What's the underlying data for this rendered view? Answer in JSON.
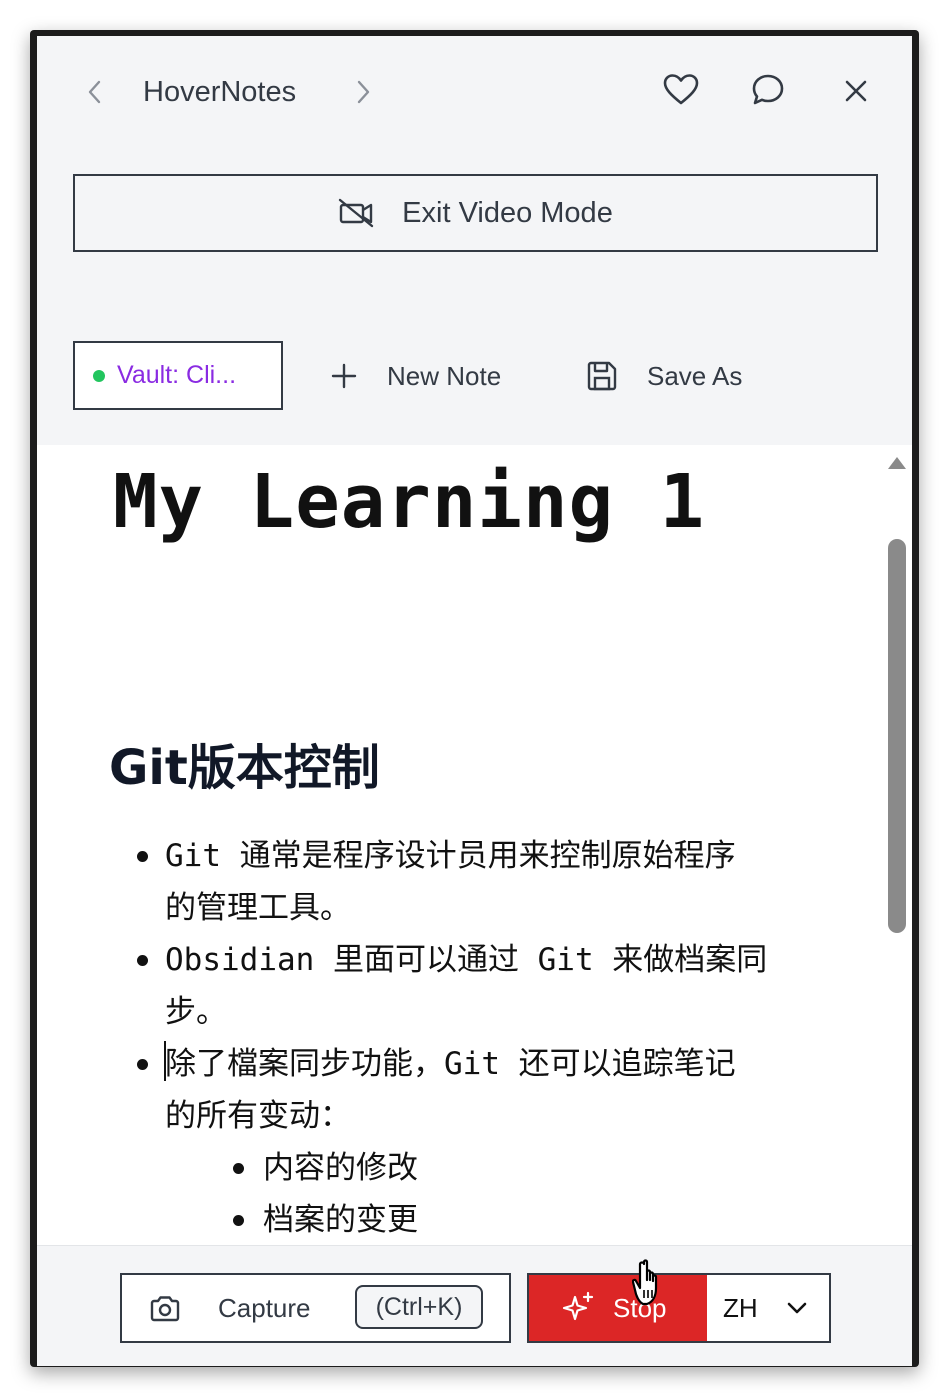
{
  "header": {
    "title": "HoverNotes"
  },
  "exit_video": {
    "label": "Exit Video Mode"
  },
  "toolbar": {
    "vault_label": "Vault: Cli...",
    "new_note_label": "New Note",
    "save_as_label": "Save As"
  },
  "document": {
    "title": "My Learning 1",
    "heading": "Git版本控制",
    "bullets": [
      {
        "line1": "Git 通常是程序设计员用来控制原始程序",
        "line2": "的管理工具。"
      },
      {
        "line1": "Obsidian 里面可以通过 Git 来做档案同",
        "line2": "步。"
      },
      {
        "line1": "除了檔案同步功能，Git 还可以追踪笔记",
        "line2": "的所有变动："
      }
    ],
    "sub_bullets": [
      "内容的修改",
      "档案的变更"
    ]
  },
  "footer": {
    "capture_label": "Capture",
    "capture_shortcut": "(Ctrl+K)",
    "stop_label": "Stop",
    "language": "ZH"
  },
  "colors": {
    "accent": "#dc2626",
    "vault_text": "#8a2be2",
    "status_dot": "#22c55e",
    "text": "#333a44"
  }
}
